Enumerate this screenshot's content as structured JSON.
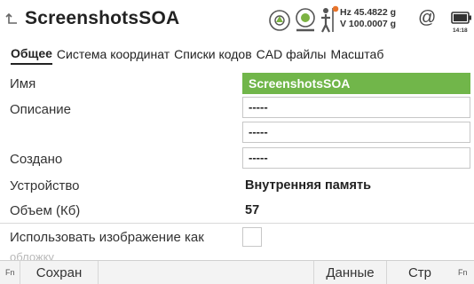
{
  "header": {
    "title": "ScreenshotsSOA",
    "hz": "Hz 45.4822 g",
    "v": "V  100.0007 g",
    "time": "14:18",
    "icons": [
      "back-icon",
      "target-icon",
      "level-icon",
      "person-antenna-icon",
      "at-icon",
      "battery-icon"
    ]
  },
  "tabs": [
    {
      "label": "Общее",
      "active": true
    },
    {
      "label": "Система координат"
    },
    {
      "label": "Списки кодов"
    },
    {
      "label": "CAD файлы"
    },
    {
      "label": "Масштаб"
    }
  ],
  "form": {
    "name_label": "Имя",
    "name_value": "ScreenshotsSOA",
    "description_label": "Описание",
    "description_value1": "-----",
    "description_value2": "-----",
    "created_label": "Создано",
    "created_value": "-----",
    "device_label": "Устройство",
    "device_value": "Внутренняя память",
    "size_label": "Объем (Кб)",
    "size_value": "57",
    "cover_label_line1": "Использовать изображение как",
    "cover_label_line2": "обложку"
  },
  "footer": {
    "fn_left": "Fn",
    "save_label": "Сохран",
    "data_label": "Данные",
    "page_label": "Стр",
    "fn_right": "Fn"
  },
  "colors": {
    "accent_green": "#71b64a"
  }
}
